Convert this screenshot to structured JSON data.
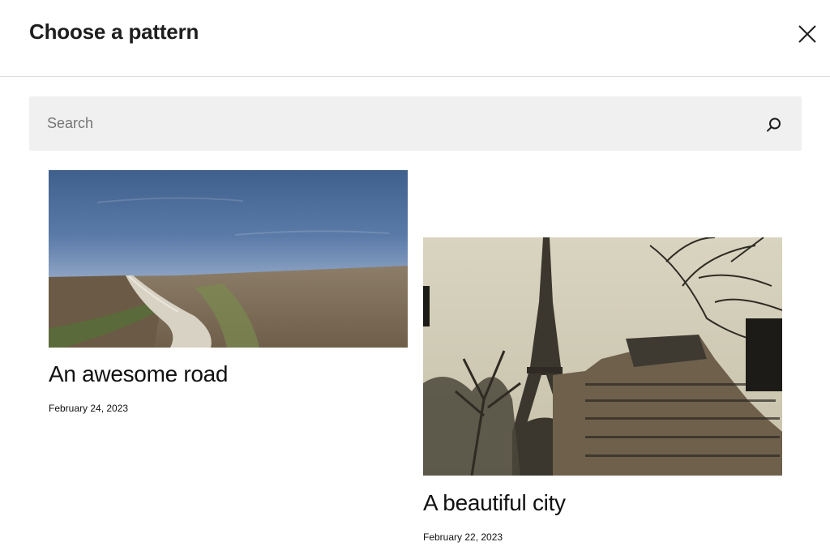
{
  "modal": {
    "title": "Choose a pattern",
    "close_icon": "close-icon"
  },
  "search": {
    "placeholder": "Search",
    "value": "",
    "icon": "search-icon"
  },
  "patterns": [
    {
      "title": "An awesome road",
      "date": "February 24, 2023",
      "image": "dirt road through plowed field under blue sky"
    },
    {
      "title": "A beautiful city",
      "date": "February 22, 2023",
      "image": "Eiffel Tower behind Parisian buildings and bare trees"
    }
  ],
  "colors": {
    "search_bg": "#f0f0f0",
    "divider": "#dddddd",
    "text": "#1e1e1e"
  }
}
